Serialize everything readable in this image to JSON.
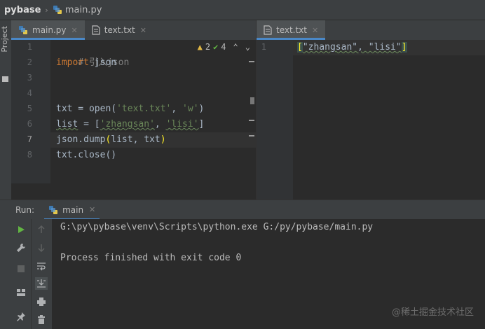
{
  "breadcrumb": {
    "project": "pybase",
    "file": "main.py"
  },
  "project_strip": {
    "label": "Project"
  },
  "left_tabs": [
    {
      "label": "main.py",
      "active": true
    },
    {
      "label": "text.txt",
      "active": false
    }
  ],
  "right_tabs": [
    {
      "label": "text.txt",
      "active": true
    }
  ],
  "inspection": {
    "warnings": "2",
    "ok": "4"
  },
  "editor_left": {
    "line_numbers": [
      "1",
      "2",
      "3",
      "4",
      "5",
      "6",
      "7",
      "8"
    ],
    "current_line": 7,
    "lines": {
      "l1": "# 引入json",
      "l2_kw": "import",
      "l2_rest": " json",
      "l5_a": "txt = ",
      "l5_b": "open(",
      "l5_s1": "'text.txt'",
      "l5_c": ", ",
      "l5_s2": "'w'",
      "l5_d": ")",
      "l6_a": "list",
      "l6_b": " = [",
      "l6_s1": "'zhangsan'",
      "l6_c": ", ",
      "l6_s2": "'lisi'",
      "l6_d": "]",
      "l7_a": "json.dump",
      "l7_p1": "(",
      "l7_b": "list, txt",
      "l7_p2": ")",
      "l8": "txt.close()"
    }
  },
  "editor_right": {
    "line_numbers": [
      "1"
    ],
    "open_bracket": "[",
    "content": "\"zhangsan\", \"lisi\"",
    "close_bracket": "]"
  },
  "run": {
    "label": "Run:",
    "tab": "main",
    "console": [
      "G:\\py\\pybase\\venv\\Scripts\\python.exe G:/py/pybase/main.py",
      "Process finished with exit code 0"
    ]
  },
  "watermark": "@稀土掘金技术社区",
  "colors": {
    "accent": "#4a88c7",
    "keyword": "#cc7832",
    "string": "#6a8759",
    "comment": "#808080",
    "run_green": "#62b543",
    "warning": "#e0b745"
  }
}
